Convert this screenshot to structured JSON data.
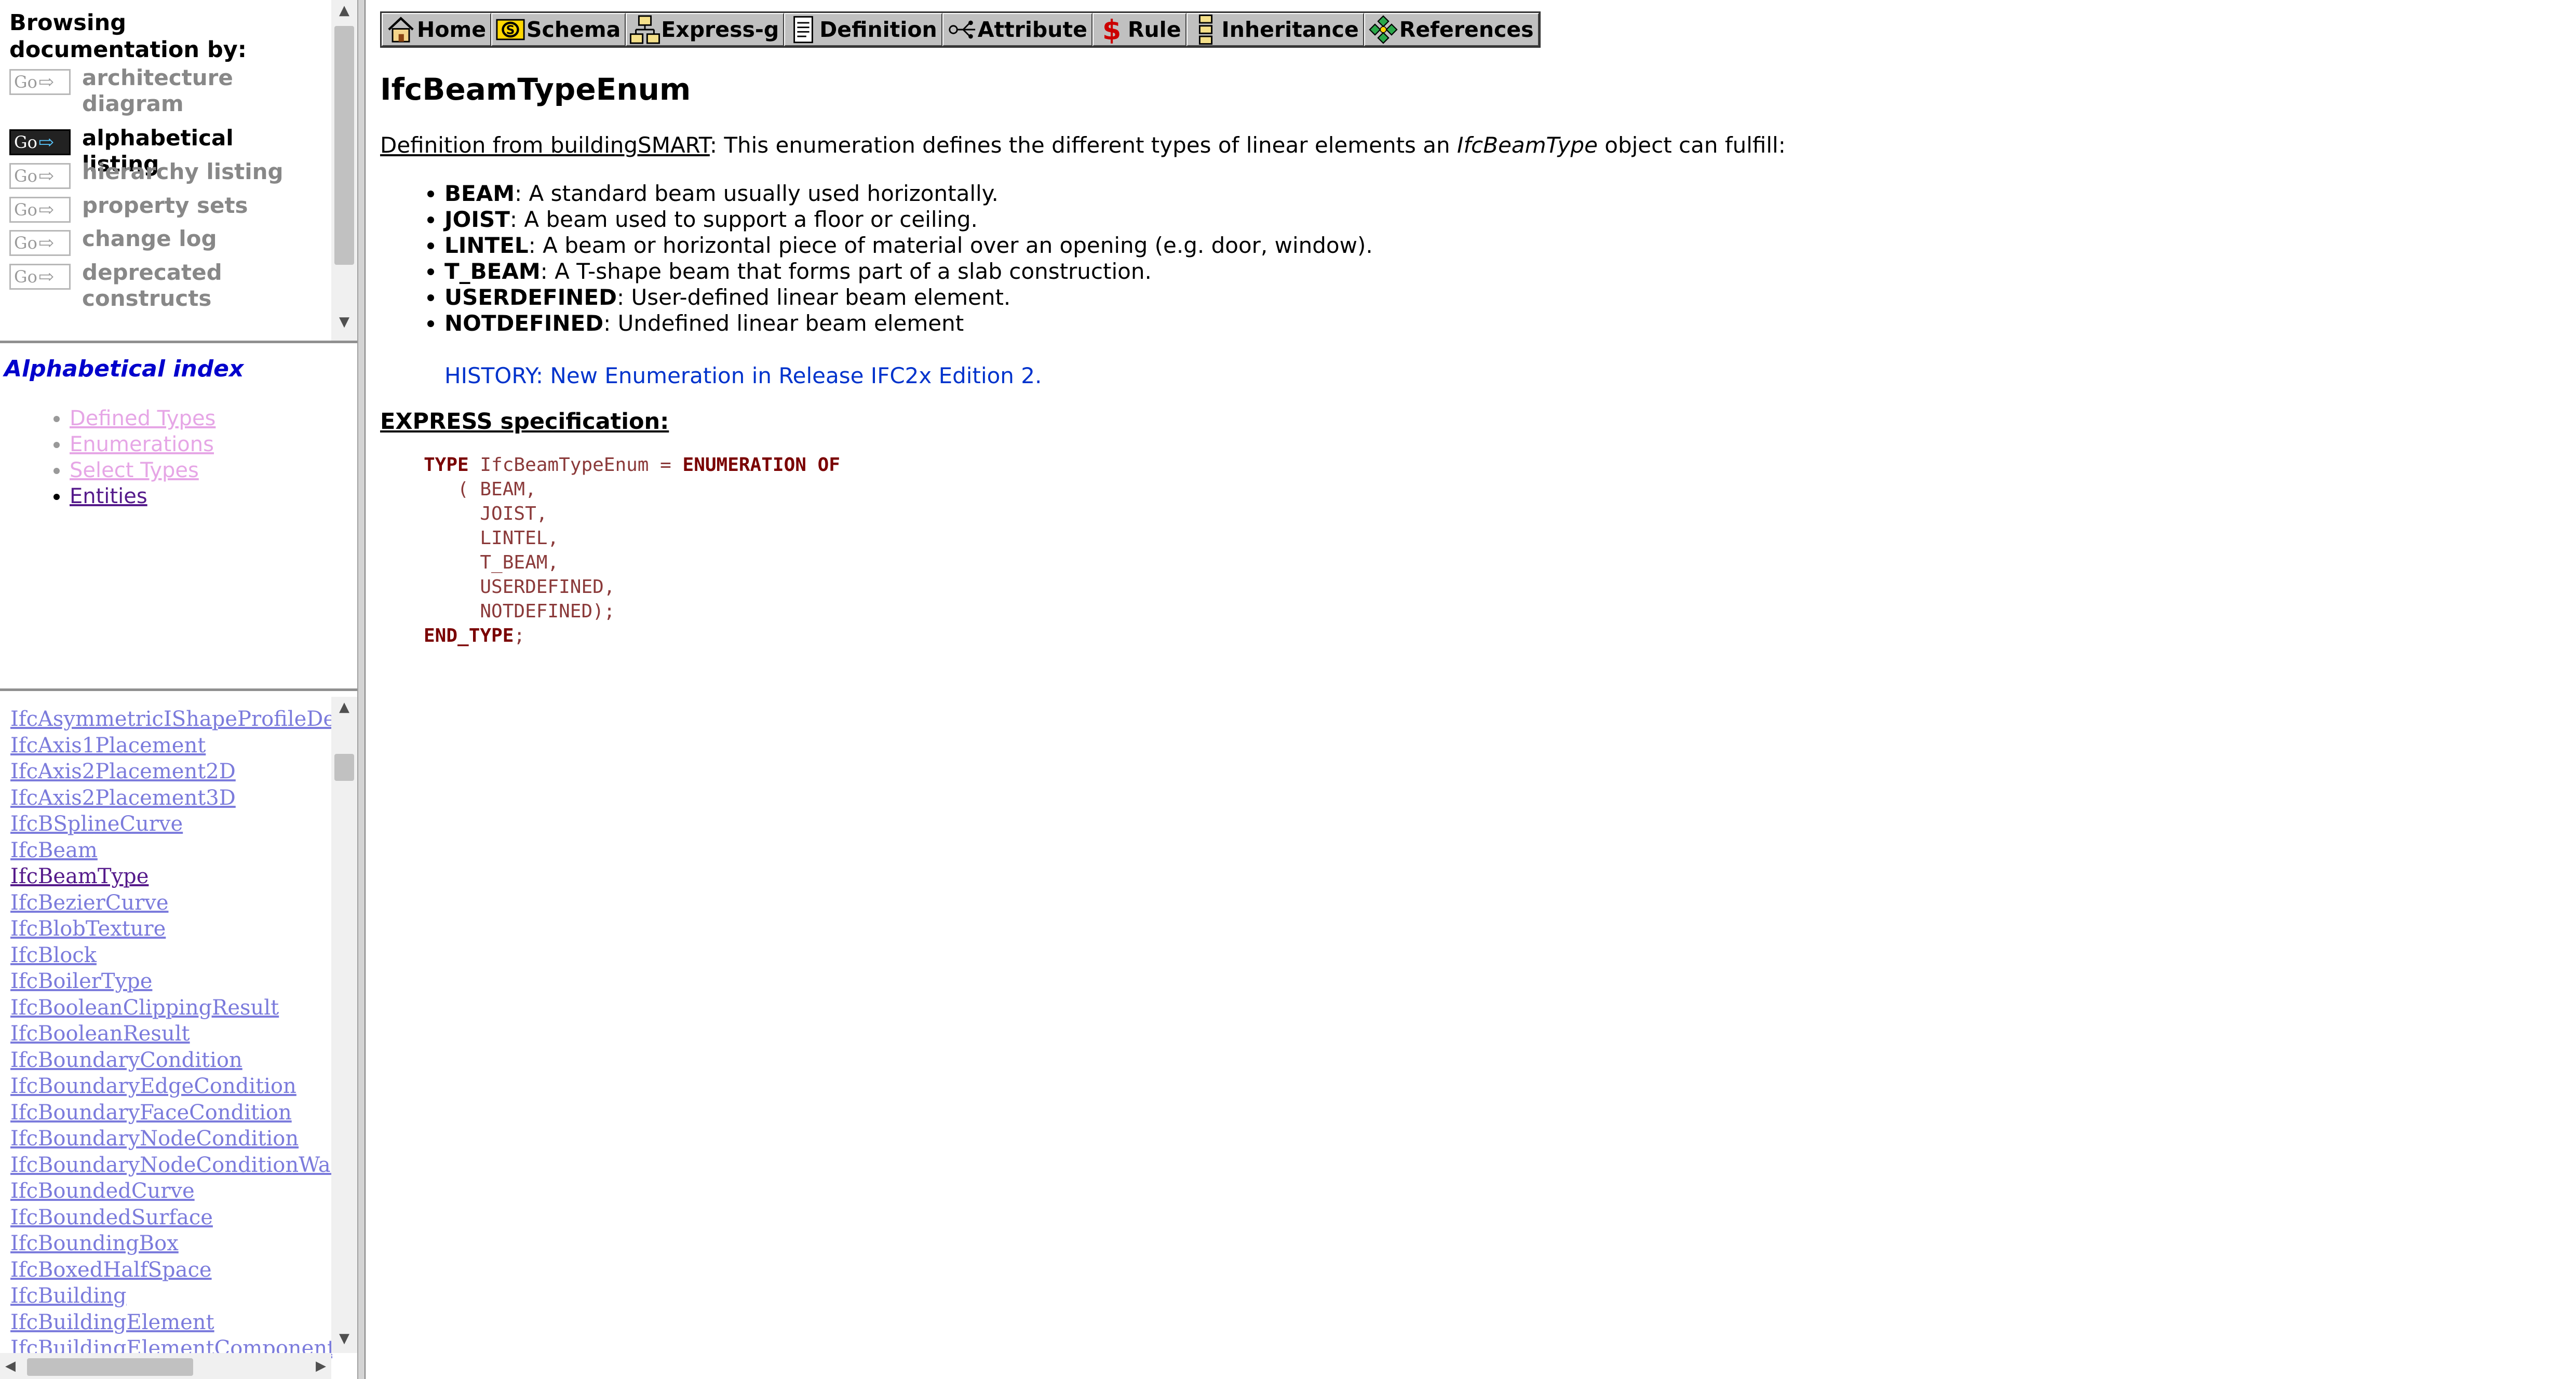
{
  "nav": {
    "heading": "Browsing documentation by:",
    "go_label": "Go",
    "items": [
      {
        "label": "architecture diagram",
        "active": false
      },
      {
        "label": "alphabetical listing",
        "active": true
      },
      {
        "label": "hierarchy listing",
        "active": false
      },
      {
        "label": "property sets",
        "active": false
      },
      {
        "label": "change log",
        "active": false
      },
      {
        "label": "deprecated constructs",
        "active": false
      }
    ]
  },
  "index": {
    "title": "Alphabetical index",
    "items": [
      {
        "label": "Defined Types"
      },
      {
        "label": "Enumerations"
      },
      {
        "label": "Select Types"
      },
      {
        "label": "Entities"
      }
    ]
  },
  "entity_list": [
    "IfcAsymmetricIShapeProfileDef",
    "IfcAxis1Placement",
    "IfcAxis2Placement2D",
    "IfcAxis2Placement3D",
    "IfcBSplineCurve",
    "IfcBeam",
    "IfcBeamType",
    "IfcBezierCurve",
    "IfcBlobTexture",
    "IfcBlock",
    "IfcBoilerType",
    "IfcBooleanClippingResult",
    "IfcBooleanResult",
    "IfcBoundaryCondition",
    "IfcBoundaryEdgeCondition",
    "IfcBoundaryFaceCondition",
    "IfcBoundaryNodeCondition",
    "IfcBoundaryNodeConditionWarping",
    "IfcBoundedCurve",
    "IfcBoundedSurface",
    "IfcBoundingBox",
    "IfcBoxedHalfSpace",
    "IfcBuilding",
    "IfcBuildingElement",
    "IfcBuildingElementComponent"
  ],
  "toolbar": {
    "home": "Home",
    "schema": "Schema",
    "express_g": "Express-g",
    "definition": "Definition",
    "attribute": "Attribute",
    "rule": "Rule",
    "inheritance": "Inheritance",
    "references": "References"
  },
  "page": {
    "title": "IfcBeamTypeEnum",
    "definition_link": "Definition from buildingSMART",
    "definition_pre": ": This enumeration defines the different types of linear elements an ",
    "definition_em": "IfcBeamType",
    "definition_post": " object can fulfill:",
    "items": [
      {
        "name": "BEAM",
        "desc": ": A standard beam usually used horizontally."
      },
      {
        "name": "JOIST",
        "desc": ": A beam used to support a floor or ceiling."
      },
      {
        "name": "LINTEL",
        "desc": ": A beam or horizontal piece of material over an opening (e.g. door, window)."
      },
      {
        "name": "T_BEAM",
        "desc": ": A T-shape beam that forms part of a slab construction."
      },
      {
        "name": "USERDEFINED",
        "desc": ": User-defined linear beam element."
      },
      {
        "name": "NOTDEFINED",
        "desc": ": Undefined linear beam element"
      }
    ],
    "history": "HISTORY: New Enumeration in Release IFC2x Edition 2.",
    "express_heading": "EXPRESS specification:",
    "code": {
      "kw_type": "TYPE",
      "type_name": " IfcBeamTypeEnum = ",
      "kw_enum": "ENUMERATION OF",
      "values": [
        "BEAM",
        "JOIST",
        "LINTEL",
        "T_BEAM",
        "USERDEFINED",
        "NOTDEFINED"
      ],
      "kw_end": "END_TYPE"
    }
  },
  "colors": {
    "link_unvisited": "#7b7bdc",
    "link_visited": "#551a8b",
    "index_title": "#0000cc",
    "history": "#0033cc",
    "code_keyword": "#7a0000"
  }
}
